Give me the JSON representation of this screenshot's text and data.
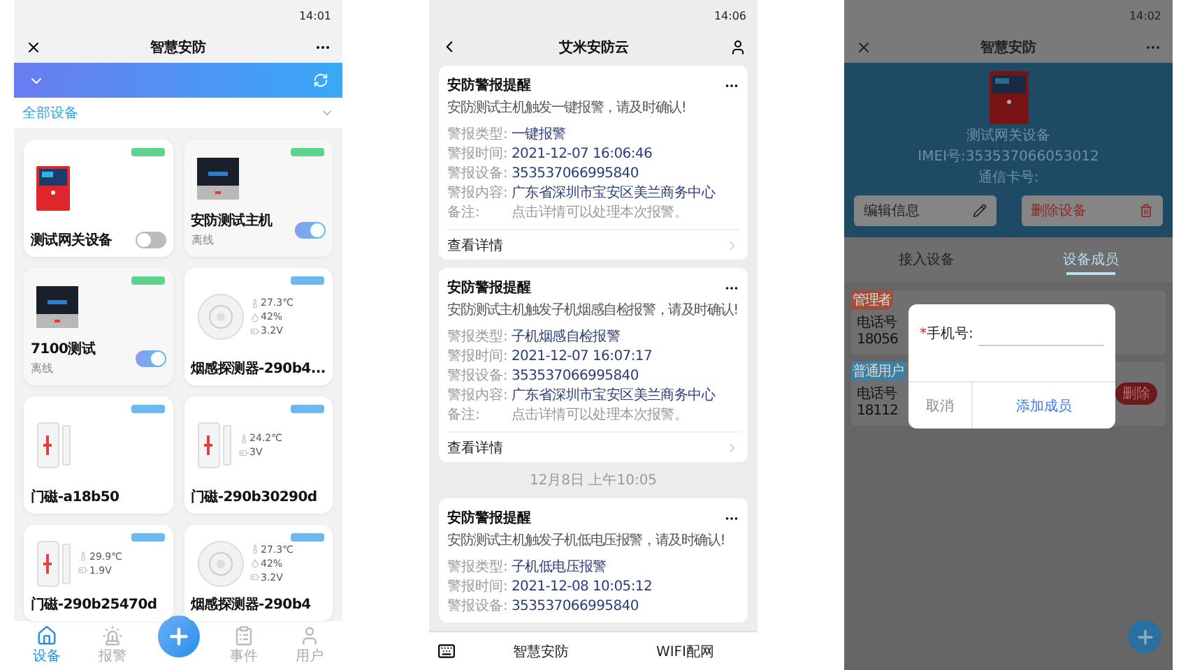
{
  "device_list_screen": {
    "status_time": "14:01",
    "title": "智慧安防",
    "filter": "全部设备",
    "devices": [
      {
        "name": "测试网关设备",
        "kind": "gateway",
        "color": "#5fd38d",
        "on": false
      },
      {
        "name": "安防测试主机",
        "status": "离线",
        "kind": "host",
        "color": "#5fd38d",
        "on": true
      },
      {
        "name": "7100测试",
        "status": "离线",
        "kind": "host",
        "color": "#5fd38d",
        "on": true
      },
      {
        "name": "烟感探测器-290b4...",
        "kind": "smoke",
        "color": "#6cb8f0",
        "readings": [
          {
            "kind": "temperature",
            "text": "27.3℃"
          },
          {
            "kind": "humidity",
            "text": "42%"
          },
          {
            "kind": "battery",
            "text": "3.2V"
          }
        ]
      },
      {
        "name": "门磁-a18b50",
        "kind": "door",
        "color": "#6cb8f0"
      },
      {
        "name": "门磁-290b30290d",
        "kind": "door",
        "color": "#6cb8f0",
        "readings": [
          {
            "kind": "temperature",
            "text": "24.2℃"
          },
          {
            "kind": "battery",
            "text": "3V"
          }
        ]
      },
      {
        "name": "门磁-290b25470d",
        "kind": "door",
        "color": "#6cb8f0",
        "readings": [
          {
            "kind": "temperature",
            "text": "29.9℃"
          },
          {
            "kind": "battery",
            "text": "1.9V"
          }
        ]
      },
      {
        "name": "烟感探测器-290b4",
        "kind": "smoke",
        "color": "#6cb8f0",
        "readings": [
          {
            "kind": "temperature",
            "text": "27.3℃"
          },
          {
            "kind": "humidity",
            "text": "42%"
          },
          {
            "kind": "battery",
            "text": "3.2V"
          }
        ]
      }
    ],
    "nav": [
      {
        "label": "设备",
        "selected": true
      },
      {
        "label": "报警",
        "selected": false
      },
      {
        "label": "事件",
        "selected": false
      },
      {
        "label": "用户",
        "selected": false
      }
    ]
  },
  "alarm_screen": {
    "status_time": "14:06",
    "title": "艾米安防云",
    "items": [
      {
        "kind": "card",
        "title": "安防警报提醒",
        "message": "安防测试主机触发一键报警，请及时确认!",
        "link": "查看详情",
        "fields": [
          {
            "label": "警报类型:",
            "value": "一键报警",
            "kind": "info"
          },
          {
            "label": "警报时间:",
            "value": "2021-12-07 16:06:46",
            "kind": "info"
          },
          {
            "label": "警报设备:",
            "value": "353537066995840",
            "kind": "info"
          },
          {
            "label": "警报内容:",
            "value": "广东省深圳市宝安区美兰商务中心",
            "kind": "info"
          },
          {
            "label": "备注:",
            "value": "点击详情可以处理本次报警。",
            "kind": "note"
          }
        ]
      },
      {
        "kind": "card",
        "title": "安防警报提醒",
        "message": "安防测试主机触发子机烟感自检报警，请及时确认!",
        "link": "查看详情",
        "fields": [
          {
            "label": "警报类型:",
            "value": "子机烟感自检报警",
            "kind": "info"
          },
          {
            "label": "警报时间:",
            "value": "2021-12-07 16:07:17",
            "kind": "info"
          },
          {
            "label": "警报设备:",
            "value": "353537066995840",
            "kind": "info"
          },
          {
            "label": "警报内容:",
            "value": "广东省深圳市宝安区美兰商务中心",
            "kind": "info"
          },
          {
            "label": "备注:",
            "value": "点击详情可以处理本次报警。",
            "kind": "note"
          }
        ]
      },
      {
        "kind": "time",
        "text": "12月8日 上午10:05"
      },
      {
        "kind": "card",
        "title": "安防警报提醒",
        "message": "安防测试主机触发子机低电压报警，请及时确认!",
        "fields": [
          {
            "label": "警报类型:",
            "value": "子机低电压报警",
            "kind": "info"
          },
          {
            "label": "警报时间:",
            "value": "2021-12-08 10:05:12",
            "kind": "info"
          },
          {
            "label": "警报设备:",
            "value": "353537066995840",
            "kind": "info"
          }
        ]
      }
    ],
    "bottom_menu": [
      "智慧安防",
      "WIFI配网"
    ]
  },
  "member_screen": {
    "status_time": "14:02",
    "title": "智慧安防",
    "device_name": "测试网关设备",
    "imei": "IMEI号:353537066053012",
    "card_number": "通信卡号:",
    "actions": [
      {
        "label": "编辑信息",
        "kind": "edit"
      },
      {
        "label": "删除设备",
        "kind": "delete"
      }
    ],
    "tabs": [
      {
        "label": "接入设备",
        "selected": false
      },
      {
        "label": "设备成员",
        "selected": true
      }
    ],
    "members": [
      {
        "role": "管理者",
        "color": "#a0503a",
        "phone_label": "电话号",
        "phone": "18056"
      },
      {
        "role": "普通用户",
        "color": "#3f7fa0",
        "phone_label": "电话号",
        "phone": "18112",
        "delete": "删除"
      }
    ],
    "dialog": {
      "required_mark": "*",
      "label": "手机号:",
      "buttons": [
        {
          "label": "取消",
          "kind": "cancel"
        },
        {
          "label": "添加成员",
          "kind": "confirm"
        }
      ]
    }
  }
}
